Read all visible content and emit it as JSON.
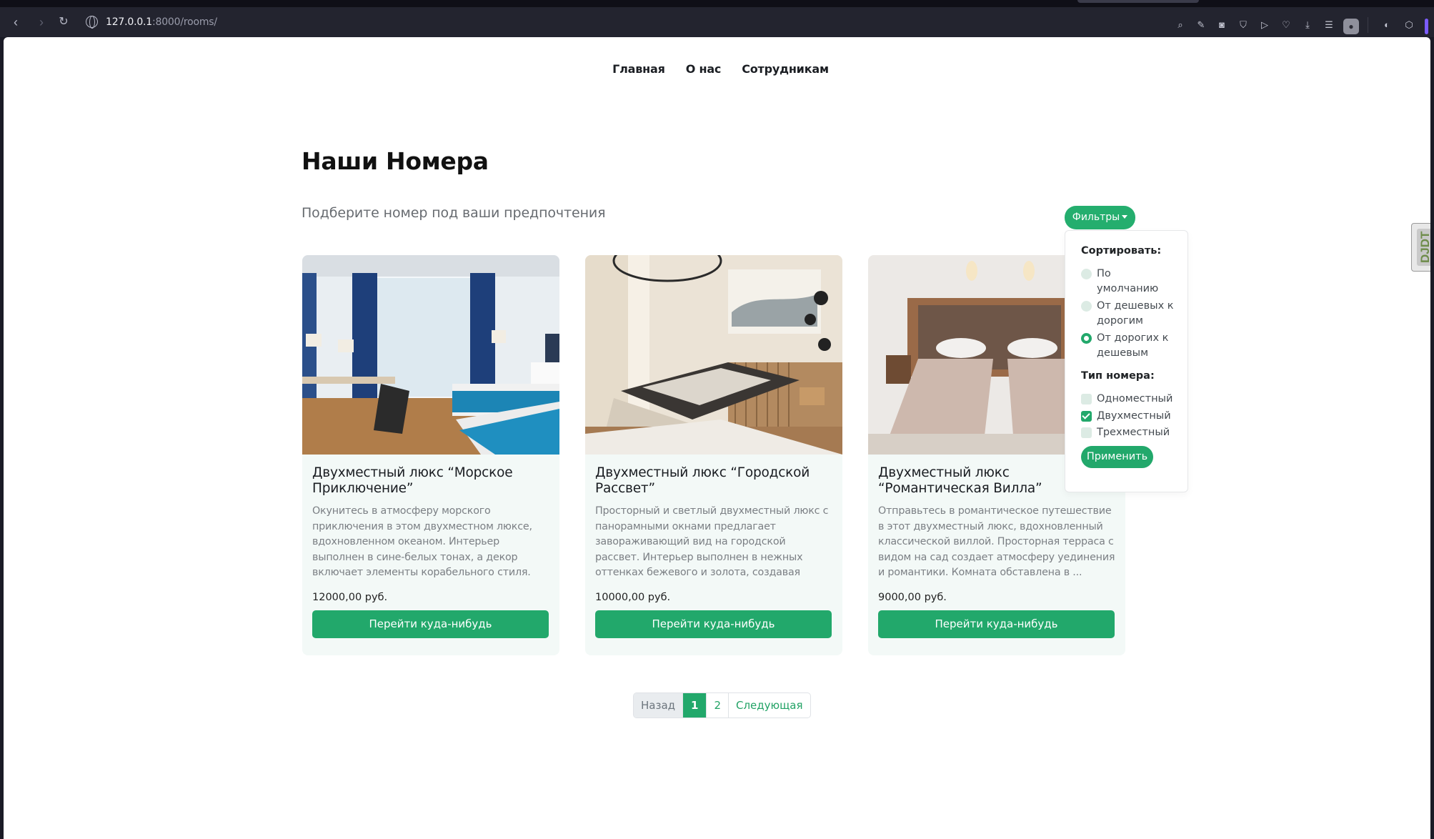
{
  "browser": {
    "url_host": "127.0.0.1",
    "url_rest": ":8000/rooms/"
  },
  "nav": {
    "items": [
      "Главная",
      "О нас",
      "Сотрудникам"
    ]
  },
  "page": {
    "title": "Наши Номера",
    "subtitle": "Подберите номер под ваши предпочтения"
  },
  "rooms": [
    {
      "title": "Двухместный люкс “Морское Приключение”",
      "description": "Окунитесь в атмосферу морского приключения в этом двухместном люксе, вдохновленном океаном. Интерьер выполнен в сине-белых тонах, а декор включает элементы корабельного стиля. Уютная кровать King ...",
      "price": "12000,00 руб.",
      "button": "Перейти куда-нибудь"
    },
    {
      "title": "Двухместный люкс “Городской Рассвет”",
      "description": "Просторный и светлый двухместный люкс с панорамными окнами предлагает завораживающий вид на городской рассвет. Интерьер выполнен в нежных оттенках бежевого и золота, создавая атмосферу тепла ...",
      "price": "10000,00 руб.",
      "button": "Перейти куда-нибудь"
    },
    {
      "title": "Двухместный люкс “Романтическая Вилла”",
      "description": "Отправьтесь в романтическое путешествие в этот двухместный люкс, вдохновленный классической виллой. Просторная терраса с видом на сад создает атмосферу уединения и романтики. Комната обставлена в ...",
      "price": "9000,00 руб.",
      "button": "Перейти куда-нибудь"
    }
  ],
  "filters": {
    "button": "Фильтры",
    "sort_heading": "Сортировать:",
    "sort_options": [
      {
        "label": "По умолчанию",
        "checked": false
      },
      {
        "label": "От дешевых к дорогим",
        "checked": false
      },
      {
        "label": "От дорогих к дешевым",
        "checked": true
      }
    ],
    "type_heading": "Тип номера:",
    "type_options": [
      {
        "label": "Одноместный",
        "checked": false
      },
      {
        "label": "Двухместный",
        "checked": true
      },
      {
        "label": "Трехместный",
        "checked": false
      }
    ],
    "apply": "Применить"
  },
  "pagination": {
    "prev": "Назад",
    "pages": [
      "1",
      "2"
    ],
    "current": "1",
    "next": "Следующая"
  },
  "toolbar": {
    "djdt": "DJDT"
  },
  "colors": {
    "accent": "#22a86b",
    "card_bg": "#f3f9f7",
    "chrome_bg": "#23242f"
  }
}
